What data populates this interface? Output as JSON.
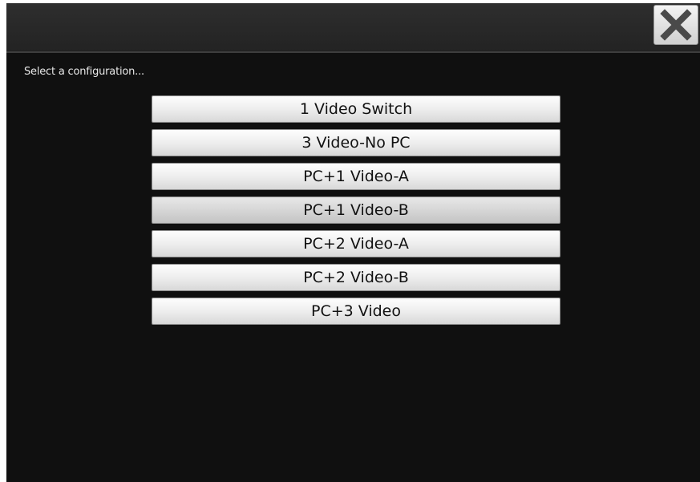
{
  "dialog": {
    "prompt": "Select a configuration...",
    "close_icon": "close-x-icon"
  },
  "configurations": [
    {
      "label": "1 Video Switch"
    },
    {
      "label": "3 Video-No PC"
    },
    {
      "label": "PC+1 Video-A"
    },
    {
      "label": "PC+1 Video-B"
    },
    {
      "label": "PC+2 Video-A"
    },
    {
      "label": "PC+2 Video-B"
    },
    {
      "label": "PC+3 Video"
    }
  ],
  "colors": {
    "background": "#101010",
    "titlebar": "#282828",
    "button_face": "#eeeeee",
    "text_light": "#e8e8e8"
  }
}
